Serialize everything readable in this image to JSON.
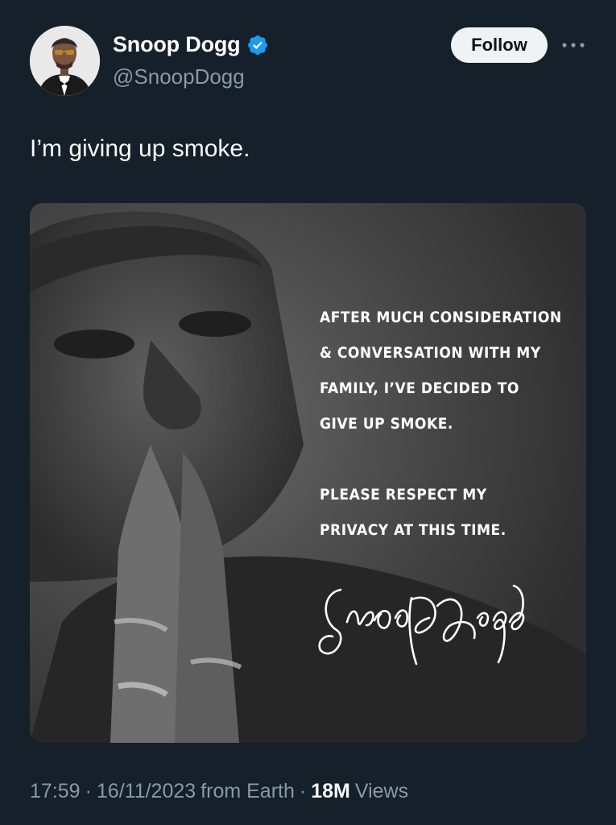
{
  "author": {
    "display_name": "Snoop Dogg",
    "handle": "@SnoopDogg",
    "verified": true,
    "verified_color": "#1d9bf0"
  },
  "actions": {
    "follow_label": "Follow",
    "more_icon": "more-horizontal-icon"
  },
  "tweet": {
    "text": "I’m giving up smoke."
  },
  "media": {
    "lines": [
      "AFTER MUCH CONSIDERATION",
      "& CONVERSATION WITH MY",
      "FAMILY, I’VE DECIDED TO",
      "GIVE UP SMOKE.",
      "PLEASE RESPECT MY",
      "PRIVACY AT THIS TIME."
    ],
    "signature_text": "Snoop Dogg"
  },
  "meta": {
    "time": "17:59",
    "separator": "·",
    "date": "16/11/2023",
    "source": "from Earth",
    "views_count": "18M",
    "views_label": "Views"
  },
  "colors": {
    "background": "#15202b",
    "secondary_text": "#8b98a5",
    "button_bg": "#eff3f4"
  }
}
